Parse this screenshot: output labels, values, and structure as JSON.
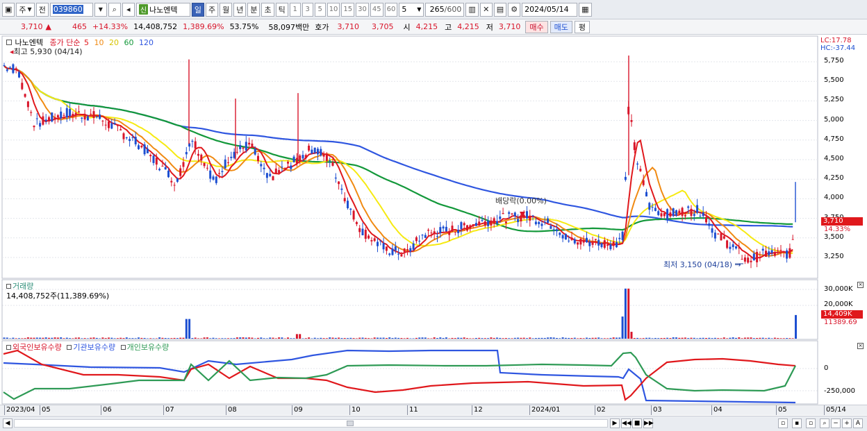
{
  "toolbar": {
    "period_main": "주",
    "prev_label": "전",
    "stock_code": "039860",
    "sin_badge": "신",
    "stock_name": "나노엔텍",
    "periods": [
      "일",
      "주",
      "월",
      "년",
      "분",
      "초",
      "틱"
    ],
    "active_period": "일",
    "numbers": [
      "1",
      "3",
      "5",
      "10",
      "15",
      "30",
      "45",
      "60"
    ],
    "interval_value": "5",
    "count_display": "265",
    "count_total": "/600",
    "date_value": "2024/05/14"
  },
  "infobar": {
    "price": "3,710",
    "change": "465",
    "change_pct": "+14.33%",
    "volume": "14,408,752",
    "volume_pct": "1,389.69%",
    "turnover_rate": "53.75%",
    "amount": "58,097백만",
    "quote_label": "호가",
    "ask": "3,710",
    "bid": "3,705",
    "open_label": "시",
    "open": "4,215",
    "high_label": "고",
    "high": "4,215",
    "low_label": "저",
    "low": "3,710",
    "buy_label": "매수",
    "sell_label": "매도",
    "eval_label": "평"
  },
  "price_panel": {
    "stock_name": "나노엔텍",
    "ma_label": "종가 단순",
    "ma_periods": [
      "5",
      "10",
      "20",
      "60",
      "120"
    ],
    "high_marker": "최고 5,930 (04/14)",
    "low_marker": "최저 3,150 (04/18)",
    "dividend_marker": "배당락(0.00%)",
    "lc": "LC:17.78",
    "hc": "HC:-37.44",
    "current_price": "3,710",
    "current_pct": "14.33%",
    "y_ticks": [
      "5,750",
      "5,500",
      "5,250",
      "5,000",
      "4,750",
      "4,500",
      "4,250",
      "4,000",
      "3,750",
      "3,500",
      "3,250"
    ]
  },
  "volume_panel": {
    "title": "거래량",
    "value": "14,408,752주(11,389.69%)",
    "y_ticks": [
      "30,000K",
      "20,000K"
    ],
    "badge": "14,409K",
    "badge_pct": "11389.69"
  },
  "holding_panel": {
    "foreign": "외국인보유수량",
    "institution": "기관보유수량",
    "individual": "개인보유수량",
    "y_ticks": [
      "0",
      "-250,000"
    ]
  },
  "x_axis": [
    "2023/04",
    "05",
    "06",
    "07",
    "08",
    "09",
    "10",
    "11",
    "12",
    "2024/01",
    "02",
    "03",
    "04",
    "05",
    "05/14"
  ],
  "colors": {
    "up": "#d8152a",
    "down": "#1d4fd1",
    "ma5": "#e0181c",
    "ma10": "#f08a12",
    "ma20": "#f6ea12",
    "ma60": "#13983a",
    "ma120": "#2f56e0",
    "foreign_line": "#e0181c",
    "institution_line": "#2f56e0",
    "individual_line": "#2e9a55"
  }
}
